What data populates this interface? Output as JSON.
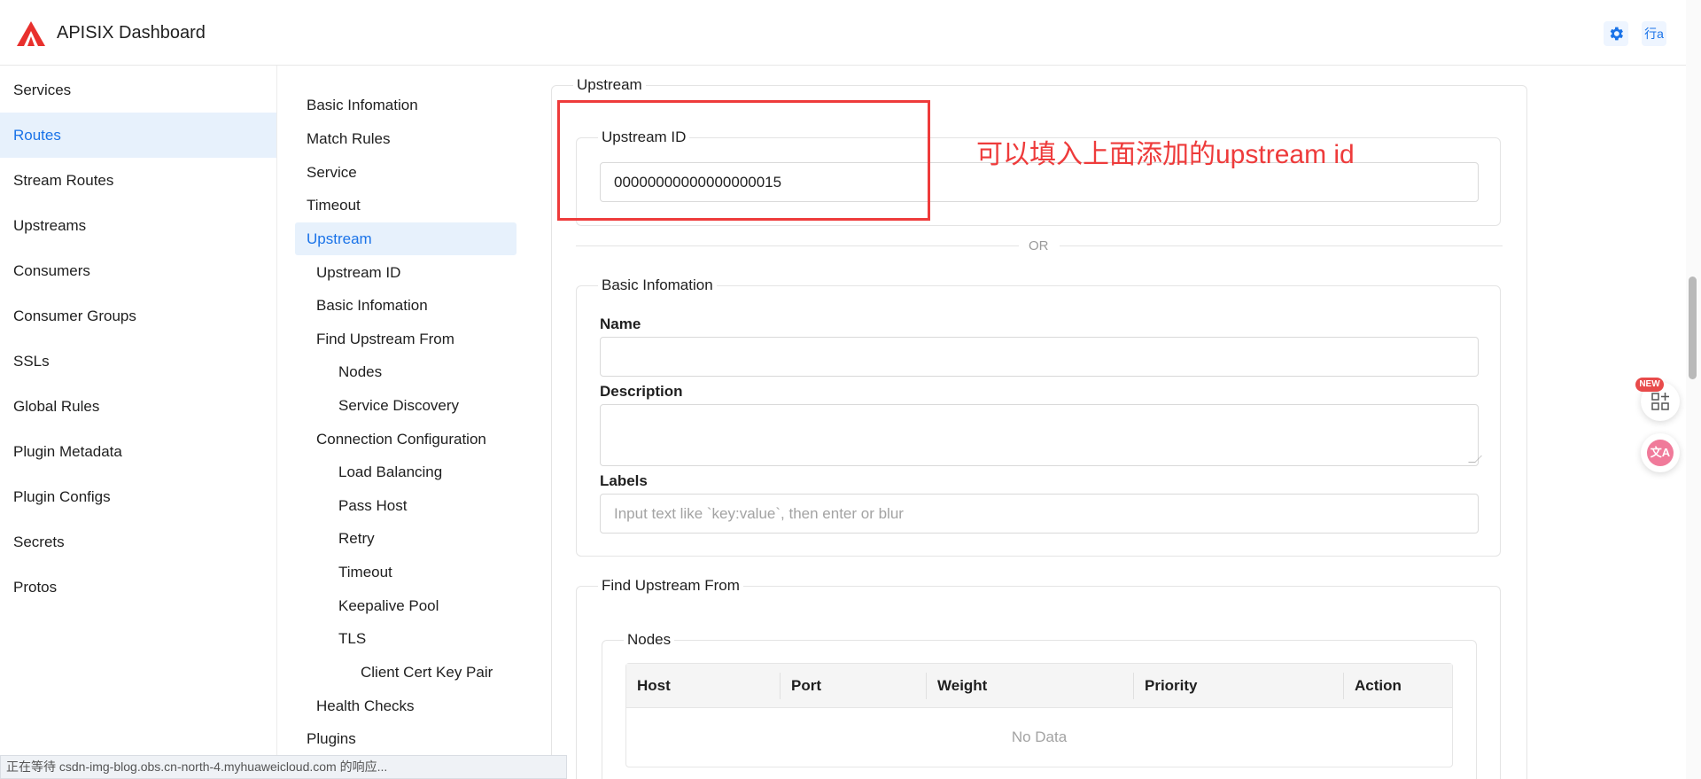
{
  "header": {
    "app_title": "APISIX Dashboard",
    "lang_icon_text": "行a",
    "brand_color": "#e8302d",
    "accent_color": "#1a73e8"
  },
  "sidebar": {
    "items": [
      {
        "label": "Services"
      },
      {
        "label": "Routes"
      },
      {
        "label": "Stream Routes"
      },
      {
        "label": "Upstreams"
      },
      {
        "label": "Consumers"
      },
      {
        "label": "Consumer Groups"
      },
      {
        "label": "SSLs"
      },
      {
        "label": "Global Rules"
      },
      {
        "label": "Plugin Metadata"
      },
      {
        "label": "Plugin Configs"
      },
      {
        "label": "Secrets"
      },
      {
        "label": "Protos"
      }
    ],
    "active": "Routes"
  },
  "anchor_nav": {
    "items": [
      {
        "label": "Basic Infomation"
      },
      {
        "label": "Match Rules"
      },
      {
        "label": "Service"
      },
      {
        "label": "Timeout"
      },
      {
        "label": "Upstream"
      },
      {
        "label": "Upstream ID"
      },
      {
        "label": "Basic Infomation"
      },
      {
        "label": "Find Upstream From"
      },
      {
        "label": "Nodes"
      },
      {
        "label": "Service Discovery"
      },
      {
        "label": "Connection Configuration"
      },
      {
        "label": "Load Balancing"
      },
      {
        "label": "Pass Host"
      },
      {
        "label": "Retry"
      },
      {
        "label": "Timeout"
      },
      {
        "label": "Keepalive Pool"
      },
      {
        "label": "TLS"
      },
      {
        "label": "Client Cert Key Pair"
      },
      {
        "label": "Health Checks"
      },
      {
        "label": "Plugins"
      }
    ],
    "active": "Upstream"
  },
  "upstream": {
    "legend": "Upstream",
    "upstream_id_legend": "Upstream ID",
    "upstream_id_value": "00000000000000000015",
    "or_text": "OR",
    "basic_info_legend": "Basic Infomation",
    "name_label": "Name",
    "name_value": "",
    "description_label": "Description",
    "labels_label": "Labels",
    "labels_placeholder": "Input text like `key:value`, then enter or blur",
    "find_upstream_legend": "Find Upstream From",
    "nodes_legend": "Nodes",
    "nodes_table": {
      "columns": [
        "Host",
        "Port",
        "Weight",
        "Priority",
        "Action"
      ],
      "empty_text": "No Data"
    }
  },
  "annotation": {
    "text": "可以填入上面添加的upstream id",
    "color": "#ee3b3b"
  },
  "statusbar": {
    "text": "正在等待 csdn-img-blog.obs.cn-north-4.myhuaweicloud.com 的响应..."
  },
  "floating": {
    "new_badge": "NEW"
  }
}
